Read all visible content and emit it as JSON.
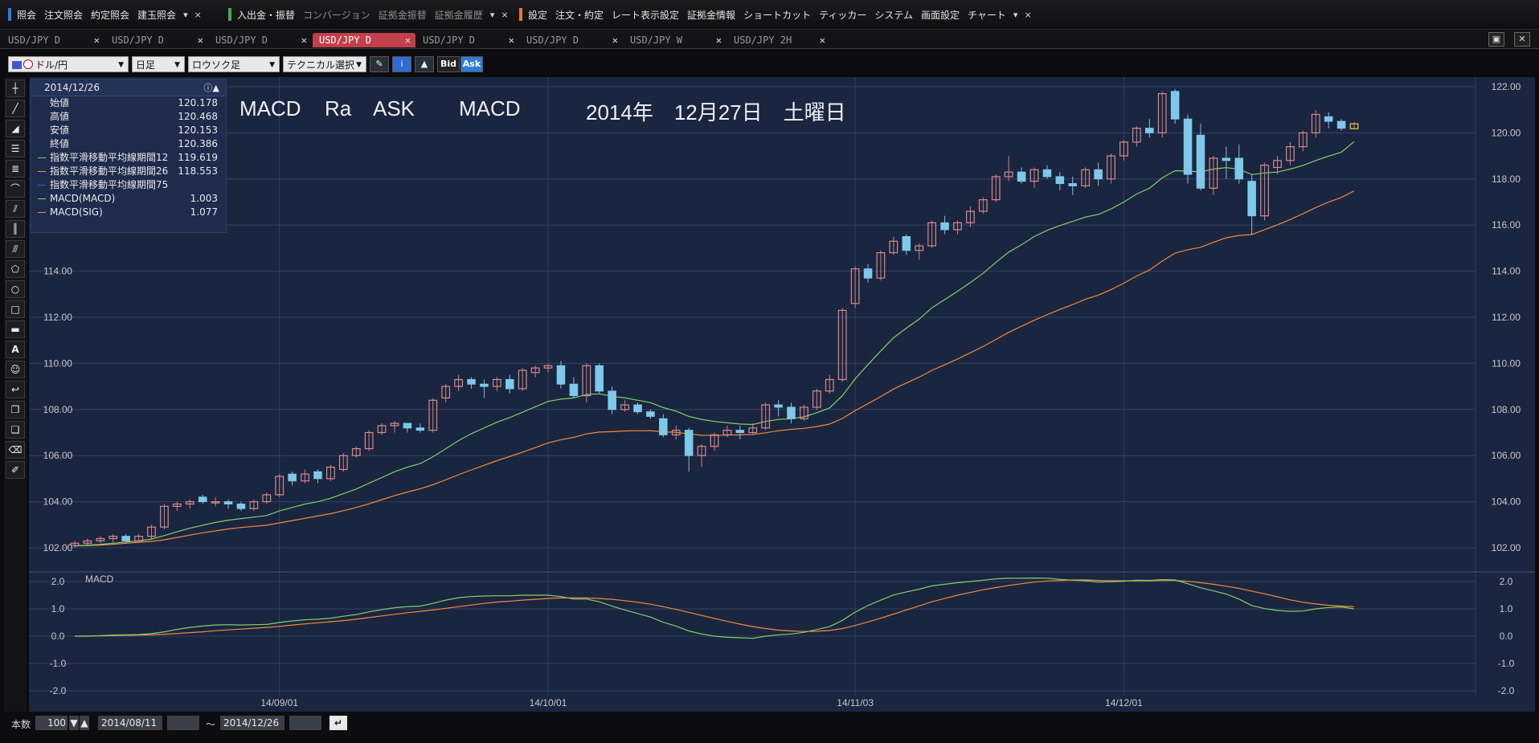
{
  "menubar": {
    "group1": [
      "照会",
      "注文照会",
      "約定照会",
      "建玉照会"
    ],
    "group2": [
      "入出金・振替",
      "コンバージョン",
      "証拠金振替",
      "証拠金履歴"
    ],
    "group3": [
      "設定",
      "注文・約定",
      "レート表示設定",
      "証拠金情報",
      "ショートカット",
      "ティッカー",
      "システム",
      "画面設定",
      "チャート"
    ],
    "dropdown": "▾",
    "close": "×"
  },
  "tabs": [
    {
      "label": "USD/JPY D"
    },
    {
      "label": "USD/JPY D"
    },
    {
      "label": "USD/JPY D"
    },
    {
      "label": "USD/JPY D",
      "active": true
    },
    {
      "label": "USD/JPY D"
    },
    {
      "label": "USD/JPY D"
    },
    {
      "label": "USD/JPY W"
    },
    {
      "label": "USD/JPY 2H"
    }
  ],
  "toolbar": {
    "currency": "ドル/円",
    "period": "日足",
    "chart_type": "ロウソク足",
    "technical": "テクニカル選択",
    "bid": "Bid",
    "ask": "Ask"
  },
  "info": {
    "date": "2014/12/26",
    "rows": [
      {
        "label": "始値",
        "value": "120.178",
        "color": ""
      },
      {
        "label": "高値",
        "value": "120.468",
        "color": ""
      },
      {
        "label": "安値",
        "value": "120.153",
        "color": ""
      },
      {
        "label": "終値",
        "value": "120.386",
        "color": ""
      },
      {
        "label": "指数平滑移動平均線期間12",
        "value": "119.619",
        "color": "#7fd06a"
      },
      {
        "label": "指数平滑移動平均線期間26",
        "value": "118.553",
        "color": "#f08a3a"
      },
      {
        "label": "指数平滑移動平均線期間75",
        "value": "",
        "color": "#3a5ad0"
      },
      {
        "label": "MACD(MACD)",
        "value": "1.003",
        "color": "#7fd06a"
      },
      {
        "label": "MACD(SIG)",
        "value": "1.077",
        "color": "#f08a3a"
      }
    ]
  },
  "title": {
    "t1": "MACD",
    "t2": "Ra",
    "t3": "ASK",
    "t4": "MACD",
    "t5": "2014年　12月27日　土曜日"
  },
  "macd_label": "MACD",
  "bottombar": {
    "count_label": "本数",
    "count": "100",
    "from": "2014/08/11",
    "tilde": "〜",
    "to": "2014/12/26"
  },
  "colors": {
    "bg": "#1a2540",
    "up": "#d98a8a",
    "down": "#7ec8ea",
    "ema12": "#7fd06a",
    "ema26": "#f08a3a",
    "grid": "#34405e"
  },
  "chart_data": {
    "type": "candlestick",
    "ylim": [
      102,
      122
    ],
    "yticks": [
      "122.00",
      "120.00",
      "118.00",
      "116.00",
      "114.00",
      "112.00",
      "110.00",
      "108.00",
      "106.00",
      "104.00",
      "102.00"
    ],
    "xtick_labels": [
      {
        "i": 16,
        "label": "14/09/01"
      },
      {
        "i": 37,
        "label": "14/10/01"
      },
      {
        "i": 61,
        "label": "14/11/03"
      },
      {
        "i": 82,
        "label": "14/12/01"
      }
    ],
    "candles": [
      [
        102.1,
        102.3,
        102.0,
        102.2
      ],
      [
        102.2,
        102.4,
        102.1,
        102.3
      ],
      [
        102.3,
        102.5,
        102.2,
        102.4
      ],
      [
        102.4,
        102.6,
        102.2,
        102.5
      ],
      [
        102.5,
        102.6,
        102.2,
        102.3
      ],
      [
        102.3,
        102.6,
        102.2,
        102.5
      ],
      [
        102.5,
        103.0,
        102.4,
        102.9
      ],
      [
        102.9,
        103.9,
        102.8,
        103.8
      ],
      [
        103.8,
        104.0,
        103.6,
        103.9
      ],
      [
        103.9,
        104.1,
        103.7,
        104.0
      ],
      [
        104.2,
        104.3,
        103.9,
        104.0
      ],
      [
        104.0,
        104.2,
        103.8,
        104.0
      ],
      [
        104.0,
        104.1,
        103.7,
        103.9
      ],
      [
        103.9,
        104.0,
        103.6,
        103.7
      ],
      [
        103.7,
        104.1,
        103.6,
        104.0
      ],
      [
        104.0,
        104.4,
        103.9,
        104.3
      ],
      [
        104.3,
        105.2,
        104.2,
        105.1
      ],
      [
        105.2,
        105.3,
        104.7,
        104.9
      ],
      [
        104.9,
        105.4,
        104.8,
        105.2
      ],
      [
        105.3,
        105.4,
        104.8,
        105.0
      ],
      [
        105.0,
        105.6,
        104.9,
        105.5
      ],
      [
        105.4,
        106.1,
        105.3,
        106.0
      ],
      [
        106.0,
        106.4,
        105.9,
        106.3
      ],
      [
        106.3,
        107.1,
        106.2,
        107.0
      ],
      [
        107.0,
        107.4,
        106.9,
        107.3
      ],
      [
        107.3,
        107.5,
        107.0,
        107.4
      ],
      [
        107.4,
        107.4,
        107.0,
        107.2
      ],
      [
        107.2,
        107.4,
        107.0,
        107.1
      ],
      [
        107.1,
        108.5,
        107.0,
        108.4
      ],
      [
        108.5,
        109.1,
        108.3,
        109.0
      ],
      [
        109.0,
        109.5,
        108.8,
        109.3
      ],
      [
        109.3,
        109.4,
        108.9,
        109.1
      ],
      [
        109.1,
        109.3,
        108.5,
        109.0
      ],
      [
        109.0,
        109.4,
        108.8,
        109.3
      ],
      [
        109.3,
        109.5,
        108.7,
        108.9
      ],
      [
        108.9,
        109.8,
        108.8,
        109.7
      ],
      [
        109.6,
        109.9,
        109.4,
        109.8
      ],
      [
        109.8,
        110.0,
        109.6,
        109.9
      ],
      [
        109.9,
        110.1,
        108.9,
        109.1
      ],
      [
        109.1,
        109.4,
        108.5,
        108.6
      ],
      [
        108.6,
        110.0,
        108.3,
        109.9
      ],
      [
        109.9,
        110.0,
        108.7,
        108.8
      ],
      [
        108.8,
        109.0,
        107.8,
        108.0
      ],
      [
        108.0,
        108.4,
        107.9,
        108.2
      ],
      [
        108.2,
        108.3,
        107.8,
        107.9
      ],
      [
        107.9,
        108.0,
        107.6,
        107.7
      ],
      [
        107.6,
        107.8,
        106.8,
        106.9
      ],
      [
        106.9,
        107.3,
        106.7,
        107.1
      ],
      [
        107.1,
        107.2,
        105.3,
        106.0
      ],
      [
        106.0,
        106.5,
        105.5,
        106.4
      ],
      [
        106.4,
        107.0,
        106.2,
        106.9
      ],
      [
        106.9,
        107.3,
        106.8,
        107.1
      ],
      [
        107.1,
        107.3,
        106.7,
        107.0
      ],
      [
        107.0,
        107.4,
        106.9,
        107.2
      ],
      [
        107.2,
        108.3,
        107.1,
        108.2
      ],
      [
        108.2,
        108.4,
        107.7,
        108.1
      ],
      [
        108.1,
        108.3,
        107.4,
        107.6
      ],
      [
        107.6,
        108.2,
        107.5,
        108.1
      ],
      [
        108.1,
        108.9,
        108.0,
        108.8
      ],
      [
        108.8,
        109.5,
        108.7,
        109.3
      ],
      [
        109.3,
        112.4,
        109.2,
        112.3
      ],
      [
        112.6,
        114.2,
        112.4,
        114.1
      ],
      [
        114.1,
        114.3,
        113.5,
        113.7
      ],
      [
        113.7,
        114.9,
        113.6,
        114.8
      ],
      [
        114.8,
        115.5,
        114.7,
        115.3
      ],
      [
        115.5,
        115.6,
        114.7,
        114.9
      ],
      [
        114.9,
        115.2,
        114.5,
        115.1
      ],
      [
        115.1,
        116.2,
        115.0,
        116.1
      ],
      [
        116.1,
        116.4,
        115.6,
        115.8
      ],
      [
        115.8,
        116.2,
        115.6,
        116.1
      ],
      [
        116.1,
        116.8,
        115.9,
        116.6
      ],
      [
        116.6,
        117.2,
        116.5,
        117.1
      ],
      [
        117.1,
        118.2,
        117.0,
        118.1
      ],
      [
        118.1,
        119.0,
        117.9,
        118.3
      ],
      [
        118.3,
        118.5,
        117.8,
        117.9
      ],
      [
        117.9,
        118.5,
        117.6,
        118.4
      ],
      [
        118.4,
        118.6,
        118.0,
        118.1
      ],
      [
        118.1,
        118.3,
        117.5,
        117.8
      ],
      [
        117.8,
        118.1,
        117.3,
        117.7
      ],
      [
        117.7,
        118.5,
        117.6,
        118.4
      ],
      [
        118.4,
        118.7,
        117.7,
        118.0
      ],
      [
        118.0,
        119.1,
        117.8,
        119.0
      ],
      [
        119.0,
        119.7,
        118.8,
        119.6
      ],
      [
        119.6,
        120.3,
        119.4,
        120.2
      ],
      [
        120.2,
        120.6,
        119.8,
        120.0
      ],
      [
        120.0,
        121.8,
        119.8,
        121.7
      ],
      [
        121.8,
        121.9,
        120.4,
        120.6
      ],
      [
        120.6,
        120.8,
        117.8,
        118.2
      ],
      [
        119.9,
        120.4,
        117.5,
        117.6
      ],
      [
        117.6,
        119.0,
        117.3,
        118.9
      ],
      [
        118.9,
        119.4,
        118.0,
        118.8
      ],
      [
        118.9,
        119.5,
        117.8,
        118.0
      ],
      [
        117.9,
        118.2,
        115.6,
        116.4
      ],
      [
        116.4,
        118.7,
        116.2,
        118.6
      ],
      [
        118.5,
        119.0,
        118.2,
        118.8
      ],
      [
        118.8,
        119.6,
        118.6,
        119.4
      ],
      [
        119.4,
        120.1,
        119.2,
        120.0
      ],
      [
        120.0,
        121.0,
        119.8,
        120.8
      ],
      [
        120.7,
        120.9,
        120.2,
        120.5
      ],
      [
        120.5,
        120.6,
        120.1,
        120.2
      ],
      [
        120.18,
        120.47,
        120.15,
        120.39
      ]
    ],
    "ema12": [
      102.08,
      102.12,
      102.15,
      102.2,
      102.25,
      102.3,
      102.38,
      102.53,
      102.7,
      102.85,
      102.98,
      103.1,
      103.2,
      103.27,
      103.33,
      103.4,
      103.6,
      103.75,
      103.9,
      104.0,
      104.15,
      104.35,
      104.55,
      104.8,
      105.05,
      105.3,
      105.5,
      105.65,
      105.95,
      106.3,
      106.65,
      106.95,
      107.2,
      107.45,
      107.65,
      107.88,
      108.12,
      108.35,
      108.45,
      108.5,
      108.65,
      108.68,
      108.57,
      108.5,
      108.4,
      108.3,
      108.08,
      107.93,
      107.7,
      107.57,
      107.48,
      107.42,
      107.37,
      107.35,
      107.48,
      107.57,
      107.6,
      107.68,
      107.86,
      108.07,
      108.6,
      109.33,
      109.95,
      110.54,
      111.11,
      111.53,
      111.92,
      112.41,
      112.77,
      113.13,
      113.51,
      113.91,
      114.38,
      114.83,
      115.15,
      115.5,
      115.77,
      115.98,
      116.16,
      116.35,
      116.46,
      116.7,
      117.0,
      117.35,
      117.6,
      118.05,
      118.36,
      118.34,
      118.31,
      118.43,
      118.49,
      118.42,
      118.19,
      118.26,
      118.3,
      118.43,
      118.59,
      118.8,
      118.99,
      119.16,
      119.62
    ],
    "ema26": [
      102.08,
      102.1,
      102.12,
      102.15,
      102.2,
      102.24,
      102.28,
      102.35,
      102.45,
      102.55,
      102.65,
      102.73,
      102.82,
      102.88,
      102.93,
      102.98,
      103.08,
      103.18,
      103.28,
      103.38,
      103.48,
      103.61,
      103.75,
      103.91,
      104.09,
      104.26,
      104.42,
      104.56,
      104.74,
      104.95,
      105.17,
      105.38,
      105.58,
      105.78,
      105.96,
      106.15,
      106.35,
      106.55,
      106.69,
      106.79,
      106.94,
      107.02,
      107.04,
      107.07,
      107.08,
      107.08,
      107.03,
      107.01,
      106.94,
      106.88,
      106.87,
      106.89,
      106.9,
      106.92,
      106.99,
      107.08,
      107.14,
      107.18,
      107.26,
      107.37,
      107.61,
      107.95,
      108.25,
      108.56,
      108.89,
      109.15,
      109.4,
      109.7,
      109.94,
      110.19,
      110.46,
      110.73,
      111.04,
      111.35,
      111.61,
      111.87,
      112.11,
      112.34,
      112.55,
      112.78,
      112.96,
      113.2,
      113.48,
      113.79,
      114.05,
      114.44,
      114.78,
      114.93,
      115.04,
      115.25,
      115.45,
      115.55,
      115.59,
      115.8,
      116.01,
      116.24,
      116.49,
      116.76,
      117.0,
      117.2,
      117.48
    ],
    "macd": [
      0.0,
      0.01,
      0.02,
      0.04,
      0.05,
      0.06,
      0.09,
      0.16,
      0.25,
      0.32,
      0.37,
      0.41,
      0.42,
      0.41,
      0.42,
      0.43,
      0.5,
      0.56,
      0.6,
      0.62,
      0.66,
      0.73,
      0.79,
      0.89,
      0.97,
      1.04,
      1.08,
      1.1,
      1.2,
      1.32,
      1.41,
      1.45,
      1.47,
      1.48,
      1.48,
      1.5,
      1.5,
      1.5,
      1.45,
      1.36,
      1.36,
      1.26,
      1.1,
      0.96,
      0.83,
      0.7,
      0.51,
      0.37,
      0.19,
      0.08,
      0.0,
      -0.04,
      -0.06,
      -0.08,
      0.0,
      0.05,
      0.08,
      0.14,
      0.24,
      0.35,
      0.58,
      0.88,
      1.12,
      1.32,
      1.51,
      1.62,
      1.72,
      1.84,
      1.9,
      1.96,
      2.0,
      2.05,
      2.1,
      2.12,
      2.12,
      2.13,
      2.12,
      2.08,
      2.05,
      2.03,
      1.98,
      1.99,
      2.01,
      2.05,
      2.04,
      2.07,
      2.06,
      1.92,
      1.77,
      1.66,
      1.54,
      1.36,
      1.12,
      1.01,
      0.94,
      0.91,
      0.92,
      1.0,
      1.05,
      1.07,
      1.0
    ],
    "signal": [
      0.0,
      0.0,
      0.01,
      0.02,
      0.03,
      0.04,
      0.05,
      0.07,
      0.1,
      0.13,
      0.16,
      0.2,
      0.23,
      0.26,
      0.29,
      0.32,
      0.36,
      0.41,
      0.45,
      0.49,
      0.53,
      0.57,
      0.62,
      0.68,
      0.74,
      0.8,
      0.86,
      0.91,
      0.96,
      1.02,
      1.08,
      1.14,
      1.2,
      1.25,
      1.28,
      1.32,
      1.35,
      1.38,
      1.4,
      1.4,
      1.4,
      1.38,
      1.35,
      1.3,
      1.24,
      1.17,
      1.08,
      0.98,
      0.87,
      0.76,
      0.65,
      0.54,
      0.44,
      0.35,
      0.28,
      0.22,
      0.19,
      0.17,
      0.18,
      0.21,
      0.28,
      0.39,
      0.52,
      0.66,
      0.81,
      0.96,
      1.11,
      1.26,
      1.38,
      1.5,
      1.6,
      1.7,
      1.78,
      1.86,
      1.92,
      1.98,
      2.02,
      2.04,
      2.06,
      2.06,
      2.04,
      2.03,
      2.03,
      2.03,
      2.03,
      2.04,
      2.04,
      2.01,
      1.96,
      1.9,
      1.83,
      1.75,
      1.65,
      1.55,
      1.44,
      1.33,
      1.24,
      1.18,
      1.13,
      1.1,
      1.08
    ],
    "macd_ylim": [
      -2,
      2
    ],
    "macd_yticks": [
      "2.0",
      "1.0",
      "0.0",
      "-1.0",
      "-2.0"
    ]
  }
}
